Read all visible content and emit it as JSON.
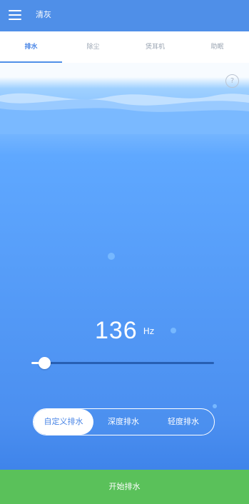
{
  "header": {
    "title": "清灰",
    "menu_icon": "menu-icon"
  },
  "tabs": [
    {
      "label": "排水",
      "active": true
    },
    {
      "label": "除尘",
      "active": false
    },
    {
      "label": "煲耳机",
      "active": false
    },
    {
      "label": "助眠",
      "active": false
    }
  ],
  "help": {
    "label": "?"
  },
  "frequency": {
    "value": "136",
    "unit": "Hz",
    "slider_level": 0.07
  },
  "modes": [
    {
      "label": "自定义排水",
      "active": true
    },
    {
      "label": "深度排水",
      "active": false
    },
    {
      "label": "轻度排水",
      "active": false
    }
  ],
  "start_button": {
    "label": "开始排水"
  },
  "colors": {
    "accent": "#4f8fe8",
    "start": "#5ac15a"
  }
}
